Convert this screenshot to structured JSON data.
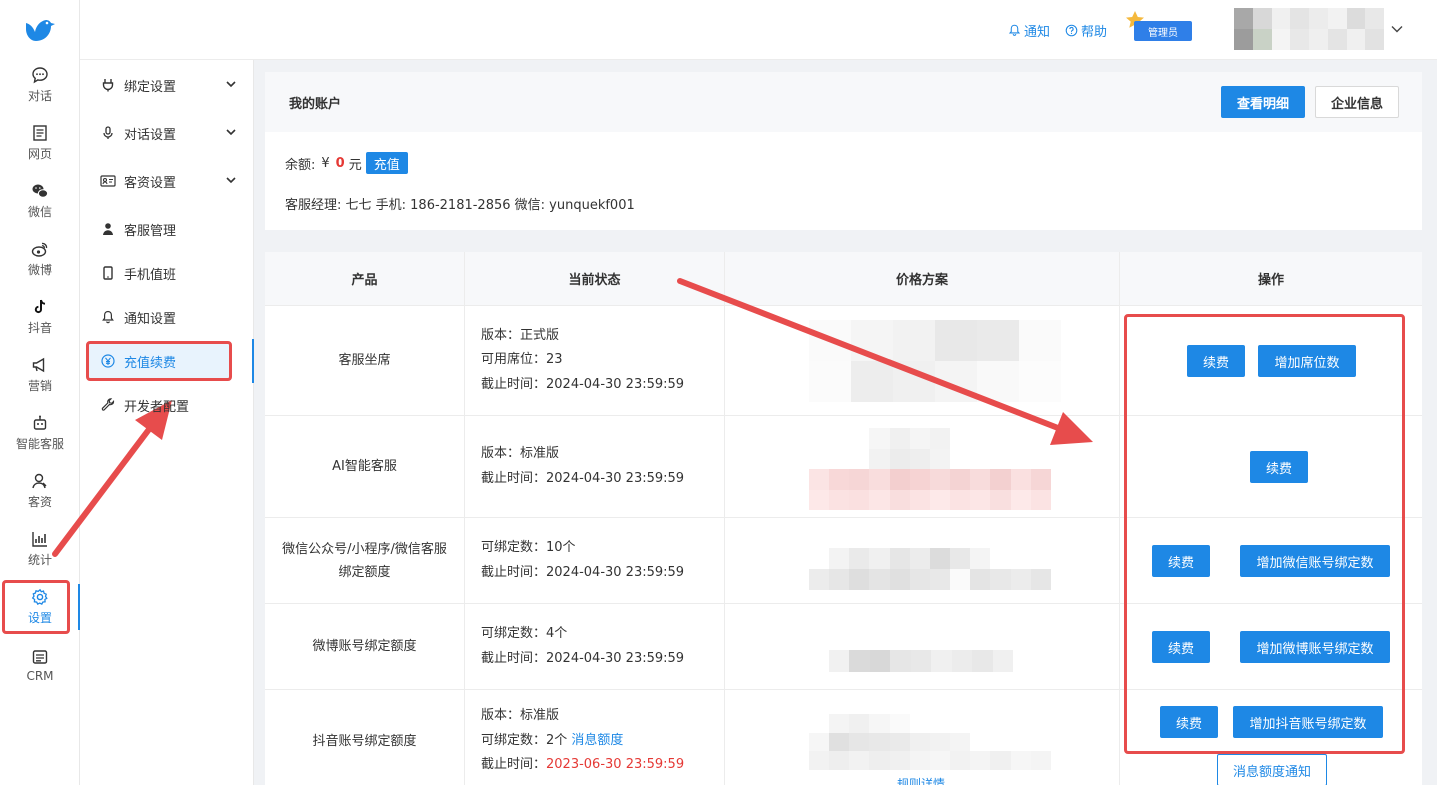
{
  "header": {
    "notify_label": "通知",
    "help_label": "帮助",
    "role_badge": "管理员"
  },
  "rail": {
    "items": [
      {
        "label": "对话",
        "icon": "chat-icon"
      },
      {
        "label": "网页",
        "icon": "webpage-icon"
      },
      {
        "label": "微信",
        "icon": "wechat-icon"
      },
      {
        "label": "微博",
        "icon": "weibo-icon"
      },
      {
        "label": "抖音",
        "icon": "douyin-icon"
      },
      {
        "label": "营销",
        "icon": "megaphone-icon"
      },
      {
        "label": "智能客服",
        "icon": "robot-icon"
      },
      {
        "label": "客资",
        "icon": "customers-icon"
      },
      {
        "label": "统计",
        "icon": "chart-icon"
      },
      {
        "label": "设置",
        "icon": "gear-icon",
        "active": true
      },
      {
        "label": "CRM",
        "icon": "crm-icon"
      }
    ]
  },
  "submenu": {
    "items": [
      {
        "label": "绑定设置",
        "icon": "plug-icon",
        "expandable": true
      },
      {
        "label": "对话设置",
        "icon": "microphone-icon",
        "expandable": true
      },
      {
        "label": "客资设置",
        "icon": "id-card-icon",
        "expandable": true
      },
      {
        "label": "客服管理",
        "icon": "user-icon"
      },
      {
        "label": "手机值班",
        "icon": "phone-icon"
      },
      {
        "label": "通知设置",
        "icon": "bell-icon"
      },
      {
        "label": "充值续费",
        "icon": "yen-icon",
        "active": true
      },
      {
        "label": "开发者配置",
        "icon": "wrench-icon"
      }
    ]
  },
  "account": {
    "title": "我的账户",
    "view_details": "查看明细",
    "company_info": "企业信息",
    "balance_label": "余额:",
    "currency": "¥",
    "balance_amount": "0",
    "balance_unit": "元",
    "recharge": "充值",
    "manager_text": "客服经理: 七七 手机: 186-2181-2856 微信: yunquekf001"
  },
  "table": {
    "headers": [
      "产品",
      "当前状态",
      "价格方案",
      "操作"
    ],
    "rows": [
      {
        "product": "客服坐席",
        "status": [
          "版本：正式版",
          "可用席位：23",
          "截止时间：2024-04-30 23:59:59"
        ],
        "ops": [
          "续费",
          "增加席位数"
        ]
      },
      {
        "product": "AI智能客服",
        "status": [
          "版本：标准版",
          "截止时间：2024-04-30 23:59:59"
        ],
        "ops": [
          "续费"
        ]
      },
      {
        "product_lines": [
          "微信公众号/小程序/微信客服",
          "绑定额度"
        ],
        "status": [
          "可绑定数：10个",
          "截止时间：2024-04-30 23:59:59"
        ],
        "ops": [
          "续费",
          "增加微信账号绑定数"
        ]
      },
      {
        "product": "微博账号绑定额度",
        "status": [
          "可绑定数：4个",
          "截止时间：2024-04-30 23:59:59"
        ],
        "ops": [
          "续费",
          "增加微博账号绑定数"
        ]
      },
      {
        "product": "抖音账号绑定额度",
        "status_version": "版本：标准版",
        "status_count": "可绑定数：2个",
        "status_link": "消息额度",
        "status_deadline_label": "截止时间：",
        "status_deadline_value": "2023-06-30 23:59:59",
        "price_link": "规则详情",
        "ops": [
          "续费",
          "增加抖音账号绑定数"
        ],
        "notify_button": "消息额度通知"
      }
    ]
  },
  "colors": {
    "primary": "#1e88e5",
    "annotation": "#e74c4c",
    "warning_text": "#e53935"
  }
}
